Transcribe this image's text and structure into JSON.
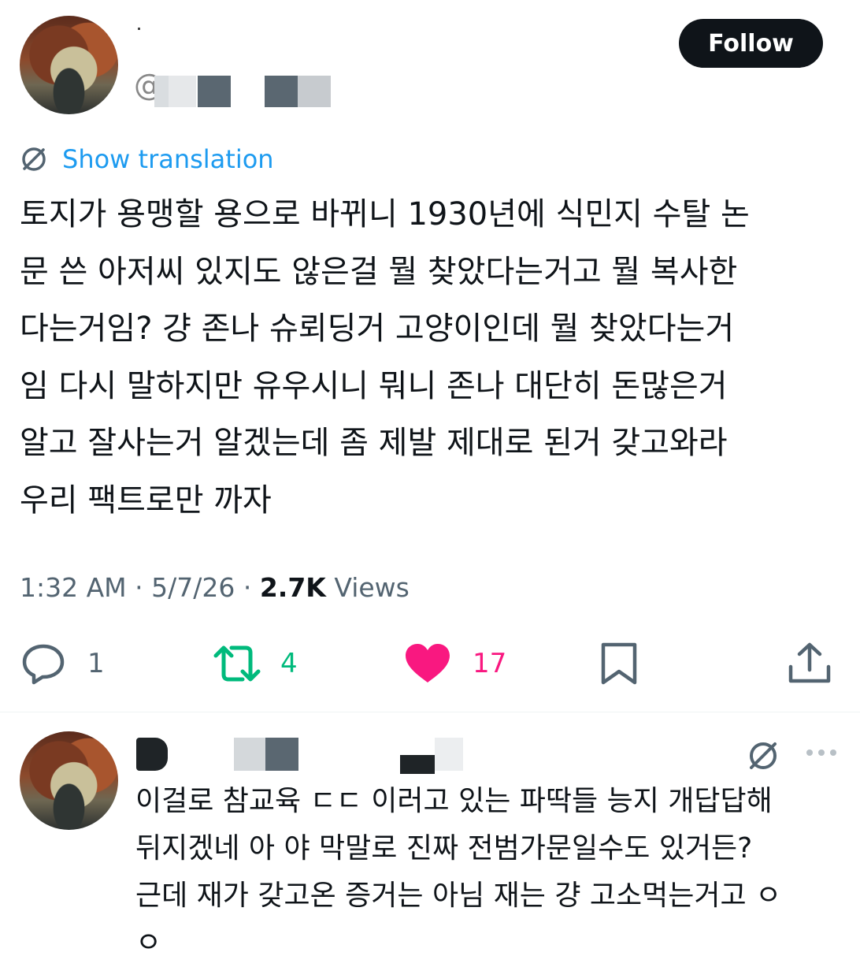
{
  "tweet": {
    "follow_label": "Follow",
    "handle_prefix": "@",
    "show_translation": "Show translation",
    "text": "토지가 용맹할 용으로 바뀌니 1930년에 식민지 수탈 논\n문 쓴 아저씨 있지도 않은걸 뭘 찾았다는거고 뭘 복사한\n다는거임? 걍 존나 슈뢰딩거 고양이인데 뭘 찾았다는거\n임 다시 말하지만 유우시니 뭐니 존나 대단히 돈많은거\n알고 잘사는거 알겠는데 좀 제발 제대로 된거 갖고와라\n우리 팩트로만 까자",
    "time": "1:32 AM",
    "date": "5/7/26",
    "separator": " · ",
    "views_count": "2.7K",
    "views_label": " Views",
    "actions": {
      "replies": "1",
      "retweets": "4",
      "likes": "17"
    }
  },
  "reply": {
    "text": "이걸로 참교육 ㄷㄷ 이러고 있는 파딱들 능지 개답답해\n뒤지겠네 아 야 막말로 진짜 전범가문일수도 있거든?\n근데 재가 갖고온 증거는 아님 재는 걍 고소먹는거고 ㅇ\nㅇ"
  },
  "colors": {
    "link": "#1d9bf0",
    "secondary_text": "#536471",
    "retweet": "#00ba7c",
    "like": "#f91880",
    "follow_bg": "#0f1419"
  },
  "icons": {
    "reply": "reply-icon",
    "retweet": "retweet-icon",
    "like": "heart-icon",
    "bookmark": "bookmark-icon",
    "share": "share-icon",
    "translate": "translate-icon",
    "more": "more-icon"
  }
}
